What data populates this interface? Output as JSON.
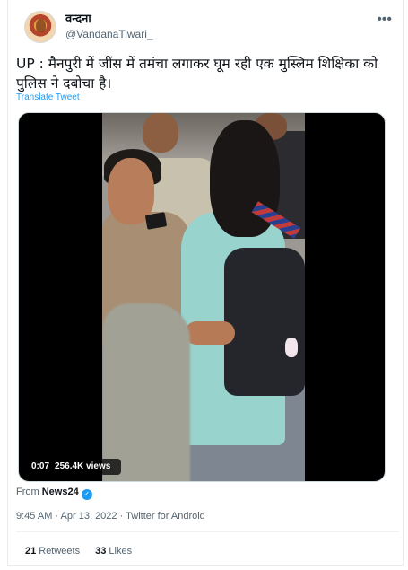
{
  "user": {
    "display_name": "वन्दना",
    "handle": "@VandanaTiwari_"
  },
  "tweet": {
    "text": "UP : मैनपुरी में जींस में तमंचा लगाकर घूम रही एक मुस्लिम शिक्षिका को पुलिस ने दबोचा है।",
    "translate_label": "Translate Tweet"
  },
  "video": {
    "time": "0:07",
    "views": "256.4K views"
  },
  "source": {
    "prefix": "From",
    "name": "News24"
  },
  "meta": {
    "time": "9:45 AM",
    "date": "Apr 13, 2022",
    "client": "Twitter for Android",
    "separator": "·"
  },
  "stats": {
    "retweets_count": "21",
    "retweets_label": "Retweets",
    "likes_count": "33",
    "likes_label": "Likes"
  },
  "icons": {
    "more": "more-icon",
    "verified": "verified-badge-icon"
  },
  "colors": {
    "accent": "#1d9bf0",
    "text": "#0f1419",
    "secondary": "#536471"
  }
}
